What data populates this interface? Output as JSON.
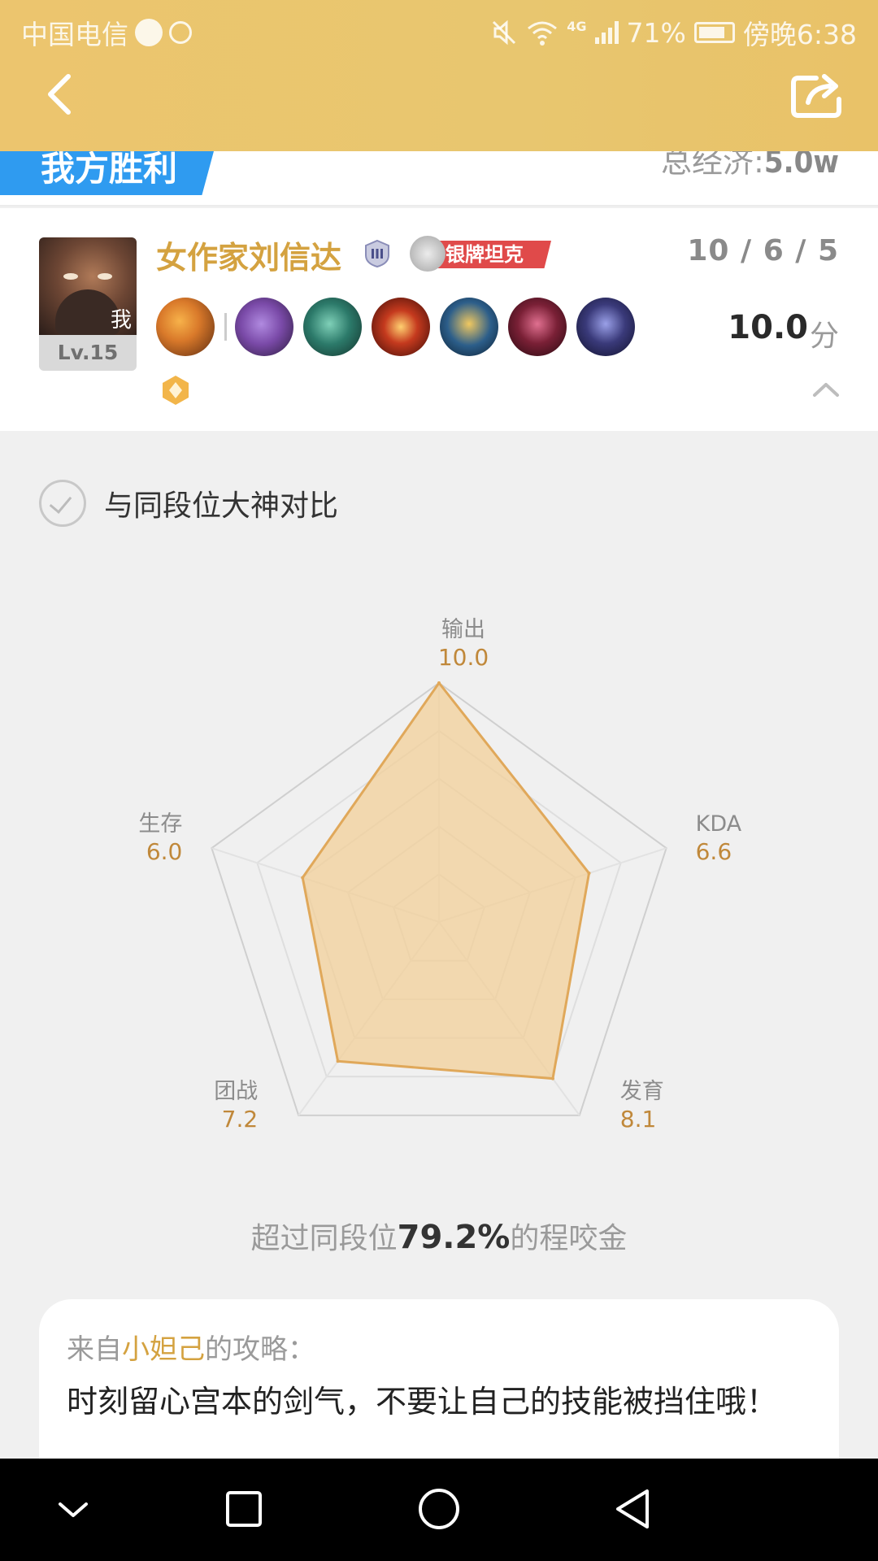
{
  "statusbar": {
    "carrier": "中国电信",
    "network": "4G",
    "battery": "71%",
    "time": "傍晚6:38"
  },
  "result": {
    "banner": "我方胜利",
    "economy_label": "总经济:",
    "economy_value": "5.0w"
  },
  "player": {
    "me_tag": "我",
    "level": "Lv.15",
    "name": "女作家刘信达",
    "medal": "银牌坦克",
    "kda": "10 / 6 / 5",
    "score": "10.0",
    "score_unit": "分",
    "items": [
      {
        "icon": "spell-flash-icon",
        "color": "#d9792a"
      },
      {
        "icon": "gauntlet-item-icon",
        "color": "#7a4aa8"
      },
      {
        "icon": "boots-item-icon",
        "color": "#2c7a6a"
      },
      {
        "icon": "fire-orb-item-icon",
        "color": "#c53a1e"
      },
      {
        "icon": "golden-axe-item-icon",
        "color": "#2c5e8a"
      },
      {
        "icon": "demon-armor-item-icon",
        "color": "#7a2036"
      },
      {
        "icon": "dark-cloak-item-icon",
        "color": "#3a3a7a"
      }
    ]
  },
  "compare": {
    "label": "与同段位大神对比"
  },
  "chart_data": {
    "type": "radar",
    "axes": [
      "输出",
      "KDA",
      "发育",
      "团战",
      "生存"
    ],
    "values": [
      10.0,
      6.6,
      8.1,
      7.2,
      6.0
    ],
    "value_labels": [
      "10.0",
      "6.6",
      "8.1",
      "7.2",
      "6.0"
    ],
    "range": [
      0,
      10
    ],
    "grid_levels": 5,
    "fill_color": "#f3cf95",
    "stroke_color": "#e0a85a"
  },
  "summary": {
    "prefix": "超过同段位",
    "percent": "79.2%",
    "suffix": "的程咬金"
  },
  "tip": {
    "from": "来自",
    "author": "小妲己",
    "after": "的攻略：",
    "text": "时刻留心宫本的剑气，不要让自己的技能被挡住哦！"
  }
}
